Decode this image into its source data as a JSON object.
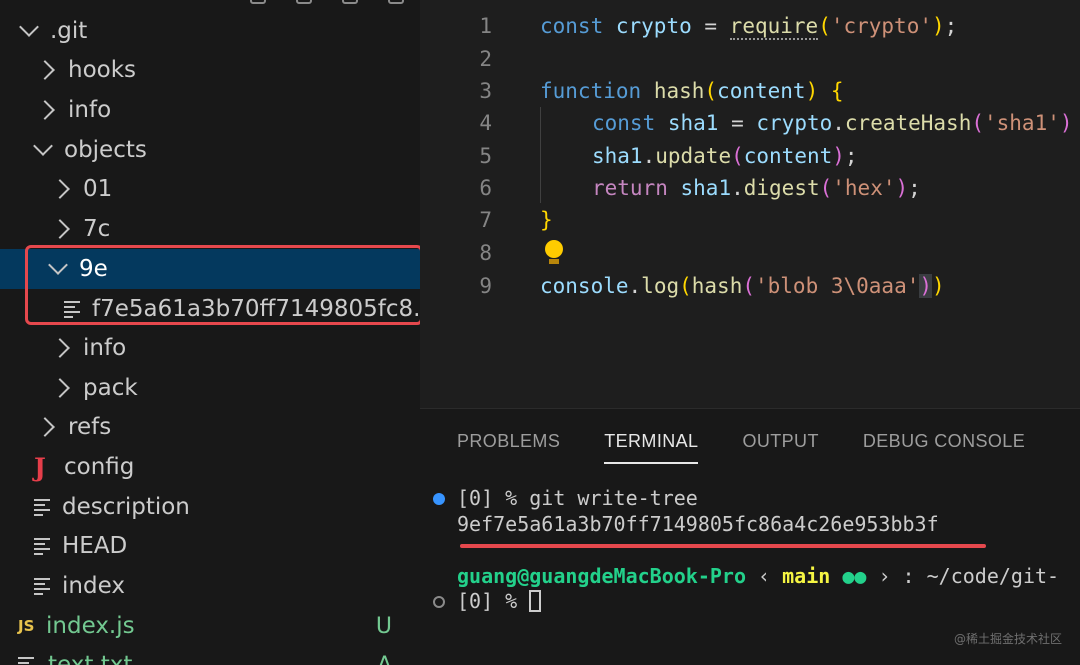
{
  "explorer": {
    "rows": [
      {
        "label": ".git",
        "type": "folder-open",
        "indent": 1
      },
      {
        "label": "hooks",
        "type": "folder-closed",
        "indent": 2
      },
      {
        "label": "info",
        "type": "folder-closed",
        "indent": 2
      },
      {
        "label": "objects",
        "type": "folder-open",
        "indent": 2
      },
      {
        "label": "01",
        "type": "folder-closed",
        "indent": 3
      },
      {
        "label": "7c",
        "type": "folder-closed",
        "indent": 3
      },
      {
        "label": "9e",
        "type": "folder-open",
        "indent": 3,
        "selected": true
      },
      {
        "label": "f7e5a61a3b70ff7149805fc8...",
        "type": "file",
        "indent": 4
      },
      {
        "label": "info",
        "type": "folder-closed",
        "indent": 3
      },
      {
        "label": "pack",
        "type": "folder-closed",
        "indent": 3
      },
      {
        "label": "refs",
        "type": "folder-closed",
        "indent": 2
      },
      {
        "label": "config",
        "type": "json",
        "icon_text": "J",
        "indent": 2
      },
      {
        "label": "description",
        "type": "file",
        "indent": 2
      },
      {
        "label": "HEAD",
        "type": "file",
        "indent": 2
      },
      {
        "label": "index",
        "type": "file",
        "indent": 2
      },
      {
        "label": "index.js",
        "type": "js",
        "icon_text": "JS",
        "indent": 1,
        "badge": "U",
        "status": "untracked"
      },
      {
        "label": "text.txt",
        "type": "file",
        "indent": 1,
        "badge": "A",
        "status": "added"
      }
    ]
  },
  "editor": {
    "line_numbers": [
      "1",
      "2",
      "3",
      "4",
      "5",
      "6",
      "7",
      "8",
      "9"
    ],
    "lines": {
      "l1": {
        "kw": "const",
        "name": "crypto",
        "eq": " = ",
        "fn": "require",
        "str": "'crypto'",
        "end": ";"
      },
      "l3": {
        "kw": "function",
        "fn": "hash",
        "param": "content"
      },
      "l4": {
        "kw": "const",
        "name": "sha1",
        "eq": " = ",
        "obj": "crypto",
        "fn": "createHash",
        "str": "'sha1'"
      },
      "l5": {
        "obj": "sha1",
        "fn": "update",
        "arg": "content",
        "end": ";"
      },
      "l6": {
        "kw": "return",
        "obj": "sha1",
        "fn": "digest",
        "str": "'hex'",
        "end": ";"
      },
      "l7": {
        "brace": "}"
      },
      "l9": {
        "obj": "console",
        "fn": "log",
        "fn2": "hash",
        "str": "'blob 3\\0aaa'"
      }
    }
  },
  "panel": {
    "tabs": [
      "PROBLEMS",
      "TERMINAL",
      "OUTPUT",
      "DEBUG CONSOLE"
    ],
    "active_tab": "TERMINAL",
    "terminal": {
      "cmd_prefix": "[0] % ",
      "cmd": "git write-tree",
      "output": "9ef7e5a61a3b70ff7149805fc86a4c26e953bb3f",
      "prompt_user": "guang@guangdeMacBook-Pro",
      "prompt_sep1": " ‹ ",
      "prompt_branch": "main",
      "prompt_dots": "●●",
      "prompt_sep2": " › : ",
      "prompt_path": "~/code/git-",
      "input_prefix": "[0] % "
    }
  },
  "watermark": "@稀土掘金技术社区",
  "colors": {
    "selection": "#04395e",
    "annotation_red": "#e5484d",
    "untracked_green": "#73c991"
  }
}
